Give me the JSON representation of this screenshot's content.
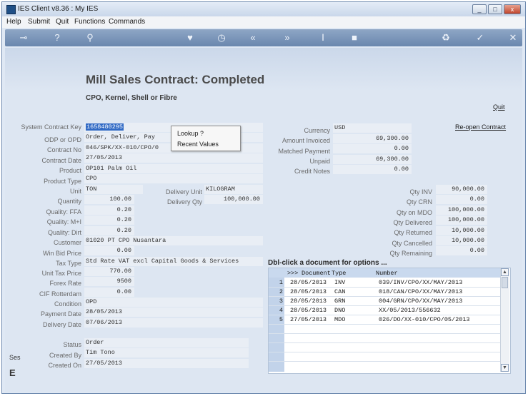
{
  "window": {
    "title": "IES Client v8.36 : My IES",
    "minimize": "_",
    "maximize": "□",
    "close": "x"
  },
  "menu": [
    "Help",
    "Submit",
    "Quit",
    "Functions",
    "Commands"
  ],
  "toolbar": {
    "icons": [
      "key-icon",
      "help-icon",
      "search-icon",
      "heart-icon",
      "clock-icon",
      "rewind-icon",
      "forward-icon",
      "text-cursor-icon",
      "stop-icon",
      "recycle-icon",
      "ok-icon",
      "close-icon"
    ],
    "glyphs": [
      "⊸",
      "?",
      "⚲",
      "♥",
      "◷",
      "«",
      "»",
      "Ⅰ",
      "■",
      "♻",
      "✓",
      "✕"
    ]
  },
  "page": {
    "title": "Mill Sales Contract: Completed",
    "subtitle": "CPO, Kernel, Shell or Fibre",
    "quit_link": "Quit",
    "reopen_link": "Re-open Contract"
  },
  "left_fields": [
    {
      "label": "System Contract Key",
      "value": "1658480295"
    },
    {
      "label": "ODP or OPD",
      "value": "Order, Deliver, Pay"
    },
    {
      "label": "Contract No",
      "value": "046/SPK/XX-010/CPO/0"
    },
    {
      "label": "Contract Date",
      "value": "27/05/2013"
    },
    {
      "label": "Product",
      "value": "OP101 Palm Oil"
    },
    {
      "label": "Product Type",
      "value": "CPO"
    },
    {
      "label": "Unit",
      "value": "TON"
    },
    {
      "label": "Quantity",
      "value": "100.00"
    },
    {
      "label": "Quality: FFA",
      "value": "0.20"
    },
    {
      "label": "Quality: M+I",
      "value": "0.20"
    },
    {
      "label": "Quality: Dirt",
      "value": "0.20"
    },
    {
      "label": "Customer",
      "value": "01020 PT CPO Nusantara"
    },
    {
      "label": "Win Bid Price",
      "value": "0.00"
    },
    {
      "label": "Tax Type",
      "value": "Std Rate VAT excl Capital Goods & Services"
    },
    {
      "label": "Unit Tax Price",
      "value": "770.00"
    },
    {
      "label": "Forex Rate",
      "value": "9500"
    },
    {
      "label": "CIF Rotterdam",
      "value": "0.00"
    },
    {
      "label": "Condition",
      "value": "OPD"
    },
    {
      "label": "Payment Date",
      "value": "28/05/2013"
    },
    {
      "label": "Delivery Date",
      "value": "07/06/2013"
    }
  ],
  "delivery": {
    "unit_label": "Delivery Unit",
    "unit_value": "KILOGRAM",
    "qty_label": "Delivery Qty",
    "qty_value": "100,000.00"
  },
  "bottom_fields": [
    {
      "label": "Status",
      "value": "Order"
    },
    {
      "label": "Created By",
      "value": "Tim Tono"
    },
    {
      "label": "Created On",
      "value": "27/05/2013"
    }
  ],
  "right_fields": [
    {
      "label": "Currency",
      "value": "USD"
    },
    {
      "label": "Amount Invoiced",
      "value": "69,300.00"
    },
    {
      "label": "Matched Payment",
      "value": "0.00"
    },
    {
      "label": "Unpaid",
      "value": "69,300.00"
    },
    {
      "label": "Credit Notes",
      "value": "0.00"
    }
  ],
  "qty_fields": [
    {
      "label": "Qty INV",
      "value": "90,000.00"
    },
    {
      "label": "Qty CRN",
      "value": "0.00"
    },
    {
      "label": "Qty on MDO",
      "value": "100,000.00"
    },
    {
      "label": "Qty Delivered",
      "value": "100,000.00"
    },
    {
      "label": "Qty Returned",
      "value": "10,000.00"
    },
    {
      "label": "Qty Cancelled",
      "value": "10,000.00"
    },
    {
      "label": "Qty Remaining",
      "value": "0.00"
    }
  ],
  "context_menu": [
    "Lookup ?",
    "Recent Values"
  ],
  "documents": {
    "hint": "Dbl-click a document for options ...",
    "headers": [
      ">>>",
      "Document",
      "Type",
      "Number"
    ],
    "rows": [
      {
        "n": "1",
        "date": "28/05/2013",
        "type": "INV",
        "number": "039/INV/CPO/XX/MAY/2013"
      },
      {
        "n": "2",
        "date": "28/05/2013",
        "type": "CAN",
        "number": "018/CAN/CPO/XX/MAY/2013"
      },
      {
        "n": "3",
        "date": "28/05/2013",
        "type": "GRN",
        "number": "004/GRN/CPO/XX/MAY/2013"
      },
      {
        "n": "4",
        "date": "28/05/2013",
        "type": "DNO",
        "number": "XX/05/2013/556632"
      },
      {
        "n": "5",
        "date": "27/05/2013",
        "type": "MDO",
        "number": "026/DO/XX-010/CPO/05/2013"
      }
    ]
  },
  "side_clip": {
    "text_a": "Ses",
    "text_b": "E"
  }
}
